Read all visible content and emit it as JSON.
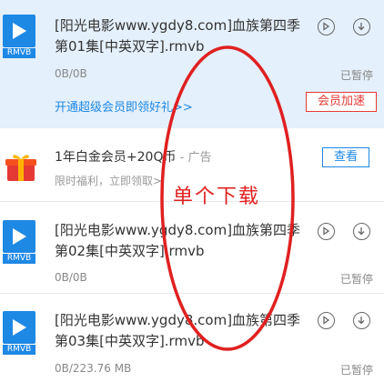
{
  "tasks": [
    {
      "format": "RMVB",
      "name_line1": "[阳光电影www.ygdy8.com]血族第四季",
      "name_line2": "第01集[中英双字].rmvb",
      "size": "0B/0B",
      "status": "已暂停",
      "promo_link": "开通超级会员即领好礼>>",
      "vip_button": "会员加速"
    },
    {
      "format": "RMVB",
      "name_line1": "[阳光电影www.ygdy8.com]血族第四季",
      "name_line2": "第02集[中英双字].rmvb",
      "size": "0B/0B",
      "status": "已暂停"
    },
    {
      "format": "RMVB",
      "name_line1": "[阳光电影www.ygdy8.com]血族第四季",
      "name_line2": "第03集[中英双字].rmvb",
      "size": "0B/223.76 MB",
      "status": "已暂停"
    }
  ],
  "ad": {
    "title": "1年白金会员+20Q币",
    "tag": " - 广告",
    "subtitle": "限时福利，立即领取>",
    "button": "查看"
  },
  "annotation": {
    "text": "单个下载",
    "color": "#e02020"
  },
  "colors": {
    "accent": "#1e88e5",
    "selected_bg": "#e4f0fb",
    "vip_red": "#e53935"
  }
}
